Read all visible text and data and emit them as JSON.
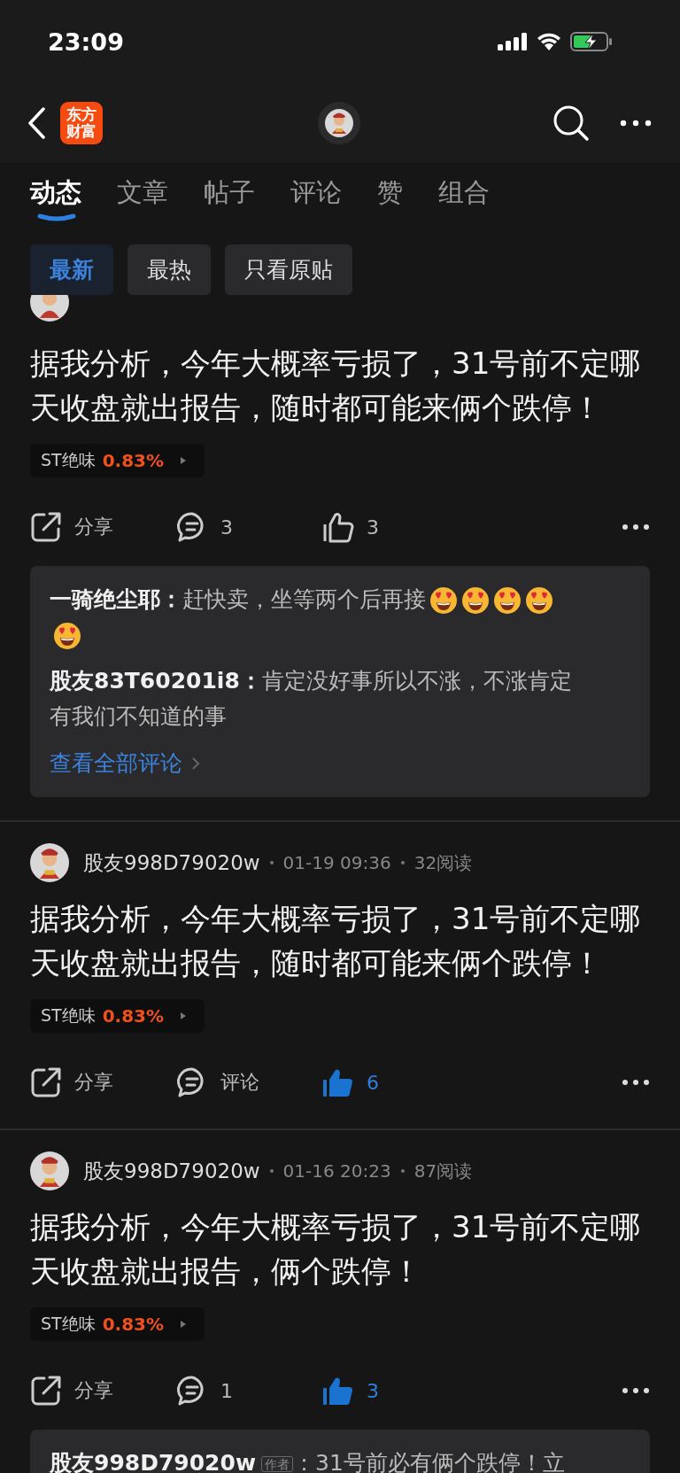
{
  "status_bar": {
    "time": "23:09"
  },
  "nav": {
    "logo_lines": [
      "东方",
      "财富"
    ]
  },
  "tabs": [
    {
      "label": "动态",
      "selected": true
    },
    {
      "label": "文章",
      "selected": false
    },
    {
      "label": "帖子",
      "selected": false
    },
    {
      "label": "评论",
      "selected": false
    },
    {
      "label": "赞",
      "selected": false
    },
    {
      "label": "组合",
      "selected": false
    }
  ],
  "filters": [
    {
      "label": "最新",
      "selected": true
    },
    {
      "label": "最热",
      "selected": false
    },
    {
      "label": "只看原贴",
      "selected": false
    }
  ],
  "posts": [
    {
      "header_clipped": true,
      "text": "据我分析，今年大概率亏损了，31号前不定哪天收盘就出报告，随时都可能来俩个跌停！",
      "stock": {
        "name": "ST绝味",
        "change": "0.83%"
      },
      "share": "分享",
      "comment": "3",
      "likes": "3",
      "liked": false,
      "comments": [
        {
          "author": "一骑绝尘耶：",
          "text": "赶快卖，坐等两个后再接",
          "icons": [
            {
              "kind": "heart-eyes"
            },
            {
              "kind": "heart-eyes"
            },
            {
              "kind": "heart-eyes"
            },
            {
              "kind": "heart-eyes"
            },
            {
              "kind": "heart-eyes"
            }
          ]
        },
        {
          "author": "股友83T60201i8：",
          "text": "肯定没好事所以不涨，不涨肯定有我们不知道的事"
        }
      ],
      "view_all": "查看全部评论"
    },
    {
      "header_clipped": false,
      "author": "股友998D79020w",
      "time": "01-19 09:36",
      "reads": "32阅读",
      "text": "据我分析，今年大概率亏损了，31号前不定哪天收盘就出报告，随时都可能来俩个跌停！",
      "stock": {
        "name": "ST绝味",
        "change": "0.83%"
      },
      "share": "分享",
      "comment": "评论",
      "likes": "6",
      "liked": true
    },
    {
      "header_clipped": false,
      "author": "股友998D79020w",
      "time": "01-16 20:23",
      "reads": "87阅读",
      "text": "据我分析，今年大概率亏损了，31号前不定哪天收盘就出报告，俩个跌停！",
      "stock": {
        "name": "ST绝味",
        "change": "0.83%"
      },
      "share": "分享",
      "comment": "1",
      "likes": "3",
      "liked": true,
      "comments": [
        {
          "author": "股友998D79020w",
          "badge": "作者",
          "text": "：31号前必有俩个跌停！立"
        }
      ]
    }
  ]
}
